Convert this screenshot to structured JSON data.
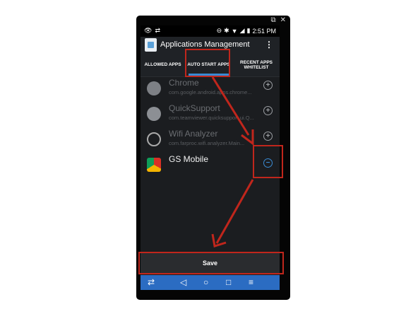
{
  "window_controls": {
    "popout_icon": "external-link-icon",
    "close_icon": "close-icon"
  },
  "status_bar": {
    "time": "2:51 PM",
    "left_icons": [
      "eye-icon",
      "teamviewer-icon"
    ],
    "right_icons": [
      "dnd-icon",
      "bluetooth-icon",
      "wifi-icon",
      "signal-icon",
      "battery-icon"
    ]
  },
  "app_bar": {
    "title": "Applications Management",
    "overflow_icon": "more-vert-icon"
  },
  "tabs": [
    {
      "label": "ALLOWED APPS"
    },
    {
      "label": "AUTO START APPS",
      "selected": true
    },
    {
      "label": "RECENT APPS WHITELIST"
    }
  ],
  "apps": [
    {
      "name": "Chrome",
      "package": "com.google.android.apps.chrome...",
      "icon": "chrome-icon",
      "action": "add",
      "enabled": false
    },
    {
      "name": "QuickSupport",
      "package": "com.teamviewer.quicksupport.ui.Q...",
      "icon": "quicksupport-icon",
      "action": "add",
      "enabled": false
    },
    {
      "name": "Wifi Analyzer",
      "package": "com.farproc.wifi.analyzer.Main...",
      "icon": "wifi-analyzer-icon",
      "action": "add",
      "enabled": false
    },
    {
      "name": "GS Mobile",
      "package": "",
      "icon": "gs-mobile-icon",
      "action": "remove",
      "enabled": true
    }
  ],
  "save_label": "Save",
  "nav_bar": {
    "icons": [
      "teamviewer-icon",
      "back-icon",
      "home-icon",
      "recents-icon",
      "menu-icon"
    ]
  },
  "annotation_color": "#c0261c",
  "accent_color": "#3a8bd4"
}
